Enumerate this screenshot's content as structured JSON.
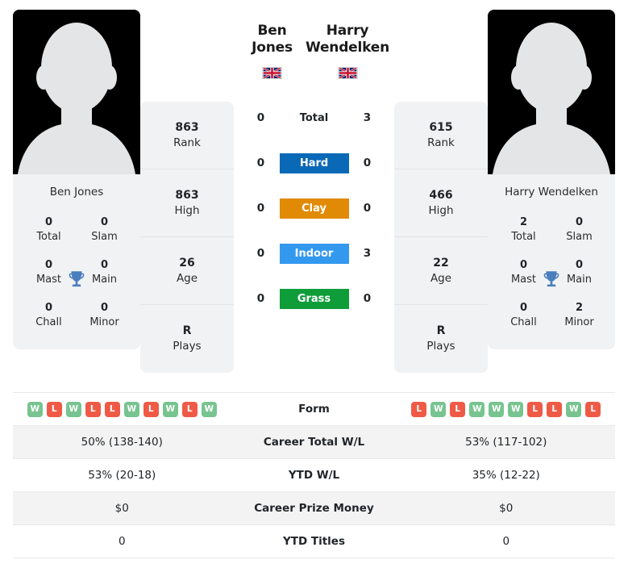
{
  "players": {
    "left": {
      "name": "Ben Jones",
      "name_under_photo": "Ben Jones",
      "flag": "gb-flag-icon",
      "avatar": "player-silhouette-placeholder",
      "stats": [
        {
          "value": "863",
          "label": "Rank"
        },
        {
          "value": "863",
          "label": "High"
        },
        {
          "value": "26",
          "label": "Age"
        },
        {
          "value": "R",
          "label": "Plays"
        }
      ],
      "titles": [
        {
          "value": "0",
          "label": "Total"
        },
        {
          "value": "0",
          "label": "Slam"
        },
        {
          "value": "0",
          "label": "Mast"
        },
        {
          "value": "0",
          "label": "Main"
        },
        {
          "value": "0",
          "label": "Chall"
        },
        {
          "value": "0",
          "label": "Minor"
        }
      ],
      "form": [
        "W",
        "L",
        "W",
        "L",
        "L",
        "W",
        "L",
        "W",
        "L",
        "W"
      ],
      "career_total_wl": "50% (138-140)",
      "ytd_wl": "53% (20-18)",
      "career_prize_money": "$0",
      "ytd_titles": "0"
    },
    "right": {
      "name": "Harry Wendelken",
      "name_under_photo": "Harry Wendelken",
      "flag": "gb-flag-icon",
      "avatar": "player-silhouette-placeholder",
      "stats": [
        {
          "value": "615",
          "label": "Rank"
        },
        {
          "value": "466",
          "label": "High"
        },
        {
          "value": "22",
          "label": "Age"
        },
        {
          "value": "R",
          "label": "Plays"
        }
      ],
      "titles": [
        {
          "value": "2",
          "label": "Total"
        },
        {
          "value": "0",
          "label": "Slam"
        },
        {
          "value": "0",
          "label": "Mast"
        },
        {
          "value": "0",
          "label": "Main"
        },
        {
          "value": "0",
          "label": "Chall"
        },
        {
          "value": "2",
          "label": "Minor"
        }
      ],
      "form": [
        "L",
        "W",
        "L",
        "W",
        "W",
        "W",
        "L",
        "L",
        "W",
        "L"
      ],
      "career_total_wl": "53% (117-102)",
      "ytd_wl": "35% (12-22)",
      "career_prize_money": "$0",
      "ytd_titles": "0"
    }
  },
  "head_to_head": {
    "rows": [
      {
        "label": "Total",
        "left": "0",
        "right": "3",
        "color": "none",
        "style": "plain"
      },
      {
        "label": "Hard",
        "left": "0",
        "right": "0",
        "color": "#0a69b7",
        "style": "chip"
      },
      {
        "label": "Clay",
        "left": "0",
        "right": "0",
        "color": "#e08a06",
        "style": "chip"
      },
      {
        "label": "Indoor",
        "left": "0",
        "right": "3",
        "color": "#3399ef",
        "style": "chip"
      },
      {
        "label": "Grass",
        "left": "0",
        "right": "0",
        "color": "#0f9d3a",
        "style": "chip"
      }
    ]
  },
  "table": {
    "rows": [
      {
        "label": "Form",
        "type": "form"
      },
      {
        "label": "Career Total W/L",
        "type": "text",
        "key": "career_total_wl"
      },
      {
        "label": "YTD W/L",
        "type": "text",
        "key": "ytd_wl"
      },
      {
        "label": "Career Prize Money",
        "type": "text",
        "key": "career_prize_money"
      },
      {
        "label": "YTD Titles",
        "type": "text",
        "key": "ytd_titles"
      }
    ]
  },
  "colors": {
    "hard": "#0a69b7",
    "clay": "#e08a06",
    "indoor": "#3399ef",
    "grass": "#0f9d3a",
    "win": "#77c490",
    "loss": "#ef5a46",
    "trophy": "#4a7fbd",
    "panel": "#f1f2f3"
  }
}
